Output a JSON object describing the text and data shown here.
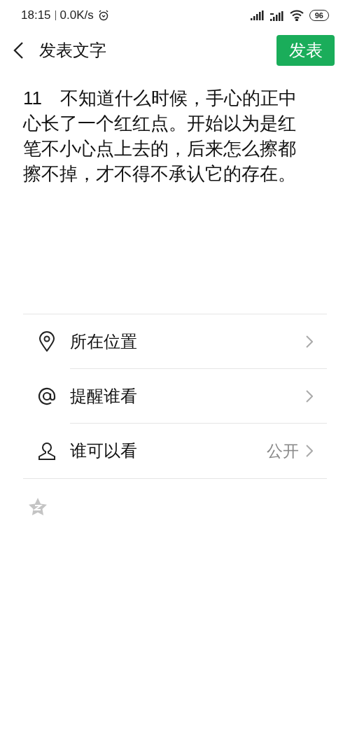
{
  "status_bar": {
    "time": "18:15",
    "network_speed": "0.0K/s",
    "battery": "96"
  },
  "header": {
    "title": "发表文字",
    "publish_button": "发表"
  },
  "post_text": "11　不知道什么时候，手心的正中心长了一个红红点。开始以为是红笔不小心点上去的，后来怎么擦都擦不掉，才不得不承认它的存在。",
  "options": [
    {
      "kind": "location",
      "label": "所在位置"
    },
    {
      "kind": "mention",
      "label": "提醒谁看"
    },
    {
      "kind": "visibility",
      "label": "谁可以看",
      "value": "公开"
    }
  ]
}
